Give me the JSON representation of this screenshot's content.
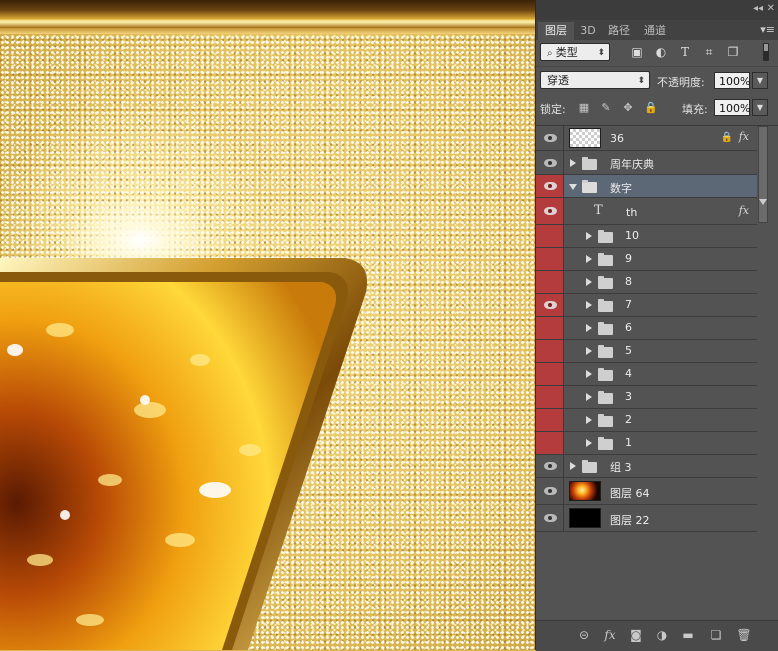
{
  "panel": {
    "tabs": [
      {
        "label": "图层",
        "active": true
      },
      {
        "label": "3D",
        "active": false
      },
      {
        "label": "路径",
        "active": false
      },
      {
        "label": "通道",
        "active": false
      }
    ],
    "filter": {
      "type_label": "类型",
      "icons": [
        "image-filter-icon",
        "adjustment-filter-icon",
        "type-filter-icon",
        "shape-filter-icon",
        "smart-object-filter-icon"
      ]
    },
    "blend_mode": "穿透",
    "opacity_label": "不透明度:",
    "opacity_value": "100%",
    "lock_label": "锁定:",
    "fill_label": "填充:",
    "fill_value": "100%"
  },
  "layers": [
    {
      "name": "36",
      "kind": "pixel",
      "thumb": "checker",
      "eye": "visible",
      "locked": true,
      "fx": true
    },
    {
      "name": "周年庆典",
      "kind": "group",
      "eye": "visible"
    },
    {
      "name": "数字",
      "kind": "group-open",
      "eye": "red-visible",
      "selected": true
    },
    {
      "name": "th",
      "kind": "text",
      "eye": "red-visible",
      "fx": true
    },
    {
      "name": "10",
      "kind": "subgroup",
      "eye": "red"
    },
    {
      "name": "9",
      "kind": "subgroup",
      "eye": "red"
    },
    {
      "name": "8",
      "kind": "subgroup",
      "eye": "red"
    },
    {
      "name": "7",
      "kind": "subgroup",
      "eye": "red-visible"
    },
    {
      "name": "6",
      "kind": "subgroup",
      "eye": "red"
    },
    {
      "name": "5",
      "kind": "subgroup",
      "eye": "red"
    },
    {
      "name": "4",
      "kind": "subgroup",
      "eye": "red"
    },
    {
      "name": "3",
      "kind": "subgroup",
      "eye": "red"
    },
    {
      "name": "2",
      "kind": "subgroup",
      "eye": "red"
    },
    {
      "name": "1",
      "kind": "subgroup",
      "eye": "red"
    },
    {
      "name": "组 3",
      "kind": "group",
      "eye": "visible"
    },
    {
      "name": "图层 64",
      "kind": "pixel",
      "thumb": "fire",
      "eye": "visible"
    },
    {
      "name": "图层 22",
      "kind": "pixel",
      "thumb": "black",
      "eye": "visible"
    }
  ],
  "bottom_icons": [
    "link-layers-icon",
    "layer-style-fx-icon",
    "add-mask-icon",
    "adjustment-layer-icon",
    "new-group-icon",
    "new-layer-icon",
    "delete-layer-icon"
  ],
  "colors": {
    "panel_bg": "#535353",
    "selected_row": "#5c6876",
    "red_eye": "#b53c3c"
  }
}
